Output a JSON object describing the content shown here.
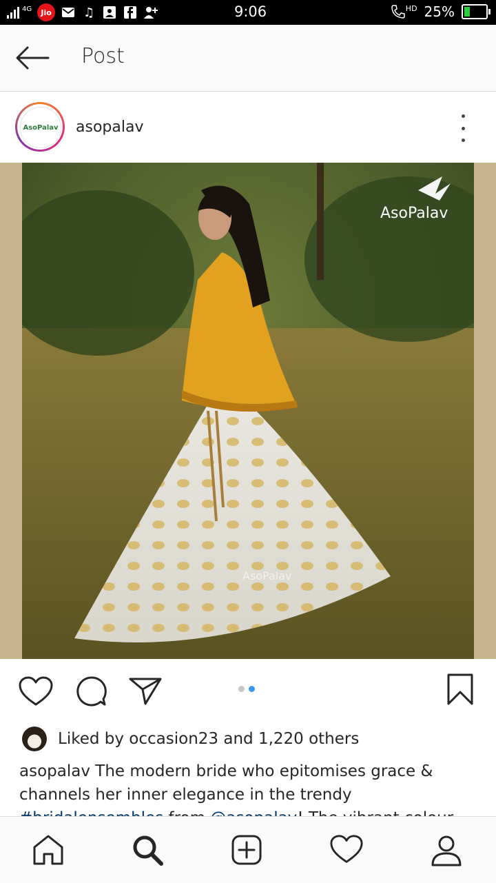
{
  "status_bar": {
    "network": "4G",
    "carrier_badge": "Jio",
    "time": "9:06",
    "hd_label": "HD",
    "battery_percent": "25%",
    "battery_level": 0.25,
    "icons": [
      "signal-icon",
      "jio-icon",
      "mail-icon",
      "music-icon",
      "gallery-icon",
      "facebook-icon",
      "contact-icon",
      "call-icon",
      "battery-icon"
    ]
  },
  "header": {
    "title": "Post"
  },
  "post": {
    "username": "asopalav",
    "avatar_label": "AsoPalav",
    "image_watermark": "AsoPalav",
    "carousel": {
      "count": 2,
      "active_index": 1
    },
    "liked_by_prefix": "Liked by",
    "liked_by_user": "occasion23",
    "liked_by_suffix": "and 1,220 others",
    "caption": {
      "user": "asopalav",
      "text1": " The modern bride who epitomises grace & channels her inner elegance in the trendy ",
      "hashtag": "#bridalensembles",
      "text2": " from ",
      "mention": "@asopalav",
      "text3": "! The vibrant colour palette of these young & modern bridal attires is"
    }
  },
  "colors": {
    "link": "#003569",
    "active_dot": "#3897f0",
    "jio_red": "#e4141b"
  }
}
